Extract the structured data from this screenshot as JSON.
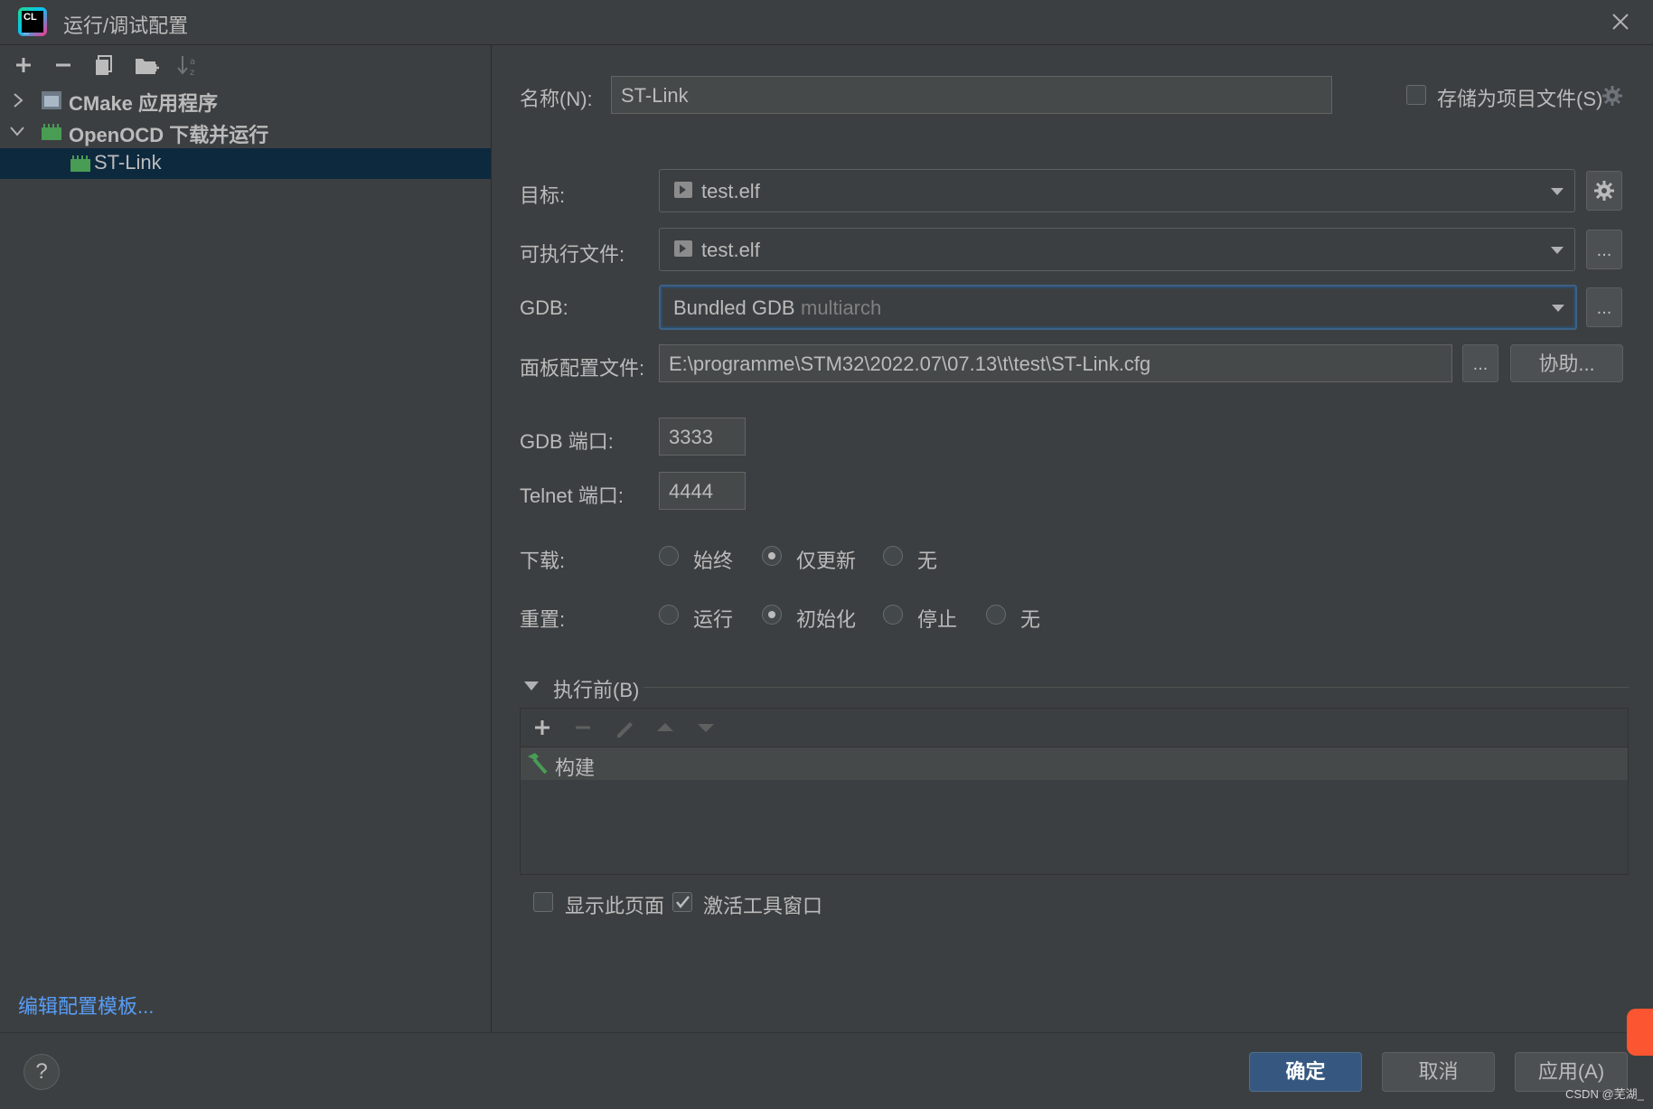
{
  "window": {
    "title": "运行/调试配置"
  },
  "tree": {
    "items": [
      {
        "label": "CMake 应用程序",
        "expanded": false
      },
      {
        "label": "OpenOCD 下载并运行",
        "expanded": true
      },
      {
        "label": "ST-Link",
        "selected": true
      }
    ]
  },
  "left": {
    "edit_templates_link": "编辑配置模板..."
  },
  "form": {
    "name_label": "名称(N):",
    "name_value": "ST-Link",
    "store_project_label": "存储为项目文件(S)",
    "store_project_checked": false,
    "target_label": "目标:",
    "target_value": "test.elf",
    "executable_label": "可执行文件:",
    "executable_value": "test.elf",
    "gdb_label": "GDB:",
    "gdb_value_main": "Bundled GDB",
    "gdb_value_suffix": "multiarch",
    "board_cfg_label": "面板配置文件:",
    "board_cfg_value": "E:\\programme\\STM32\\2022.07\\07.13\\t\\test\\ST-Link.cfg",
    "browse_label": "...",
    "assist_label": "协助...",
    "gdb_port_label": "GDB 端口:",
    "gdb_port_value": "3333",
    "telnet_port_label": "Telnet 端口:",
    "telnet_port_value": "4444",
    "download_label": "下载:",
    "download_options": [
      "始终",
      "仅更新",
      "无"
    ],
    "download_selected": "仅更新",
    "reset_label": "重置:",
    "reset_options": [
      "运行",
      "初始化",
      "停止",
      "无"
    ],
    "reset_selected": "初始化"
  },
  "before_launch": {
    "title": "执行前(B)",
    "tasks": [
      "构建"
    ],
    "show_page_label": "显示此页面",
    "show_page_checked": false,
    "activate_tool_window_label": "激活工具窗口",
    "activate_tool_window_checked": true
  },
  "footer": {
    "help_label": "?",
    "ok_label": "确定",
    "cancel_label": "取消",
    "apply_label": "应用(A)"
  },
  "watermark": "CSDN @芜湖_",
  "colors": {
    "selection": "#0d293e",
    "link": "#589df6",
    "primary_button": "#365880",
    "build_icon": "#499c54"
  }
}
